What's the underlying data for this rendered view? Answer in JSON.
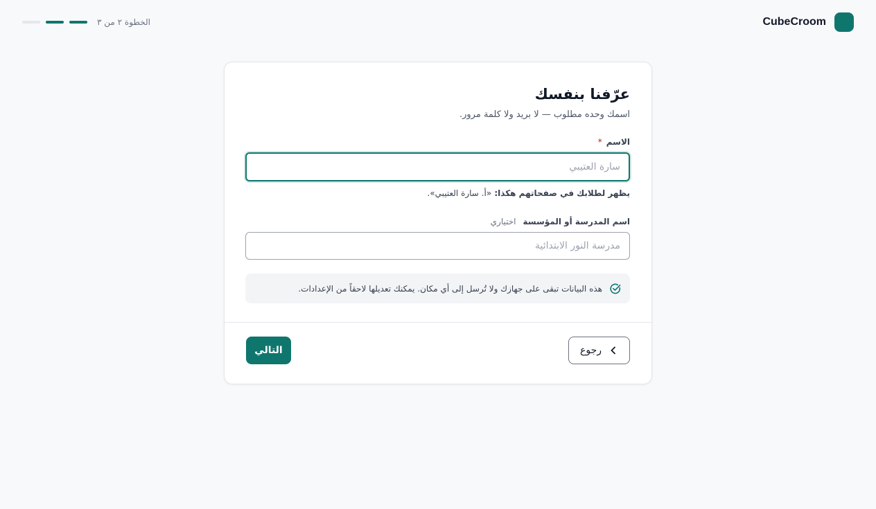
{
  "app": {
    "brand_name": "CubeCroom",
    "accent_color": "#0f766e"
  },
  "progress": {
    "step_text": "الخطوة ٢ من ٣",
    "current_step": 2,
    "total_steps": 3
  },
  "card": {
    "title": "عرّفنا بنفسك",
    "subtitle": "اسمك وحده مطلوب — لا بريد ولا كلمة مرور."
  },
  "name_field": {
    "label": "الاسم",
    "required_mark": "*",
    "placeholder": "سارة العتيبي",
    "value": "",
    "hint_prefix": "يظهر لطلابك في صفحاتهم هكذا: ",
    "hint_example": "«أ. سارة العتيبي».",
    "focused": true
  },
  "school_field": {
    "label": "اسم المدرسة أو المؤسسة",
    "optional_text": "اختياري",
    "placeholder": "مدرسة النور الابتدائية",
    "value": ""
  },
  "notice": {
    "icon": "check-circle-icon",
    "text": "هذه البيانات تبقى على جهازك ولا تُرسل إلى أي مكان. يمكنك تعديلها لاحقاً من الإعدادات."
  },
  "buttons": {
    "next_label": "التالي",
    "back_label": "رجوع",
    "back_icon": "chevron-left-icon"
  }
}
